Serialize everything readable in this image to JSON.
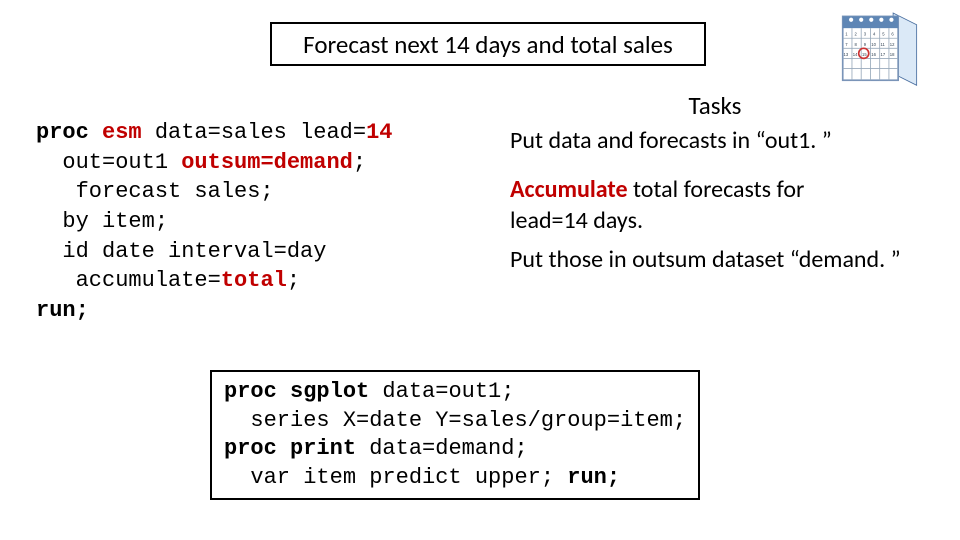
{
  "title": "Forecast next 14 days and total sales",
  "code_left": {
    "proc": "proc",
    "esm": "esm",
    "data_eq": "data=sales lead=",
    "lead_val": "14",
    "out_line": "  out=out1 ",
    "outsum_kw": "outsum=demand",
    "out_semi": ";",
    "forecast_line": "   forecast sales;",
    "by_line": "  by item;",
    "id_line": "  id date interval=day",
    "accum_pre": "   accumulate=",
    "accum_kw": "total",
    "accum_semi": ";",
    "run_line": "run;"
  },
  "tasks": {
    "heading": "Tasks",
    "p1": "Put data and forecasts in “out1. ”",
    "p2a": "Accumulate",
    "p2b": " total forecasts for",
    "p2c": "lead=14 days.",
    "p3": "Put those in outsum dataset “demand. ”"
  },
  "code_bottom": {
    "l1a": "proc sgplot",
    "l1b": " data=out1;",
    "l2": "  series X=date Y=sales/group=item;",
    "l3a": "proc print",
    "l3b": " data=demand;",
    "l4a": "  var item predict upper; ",
    "l4b": "run;"
  }
}
